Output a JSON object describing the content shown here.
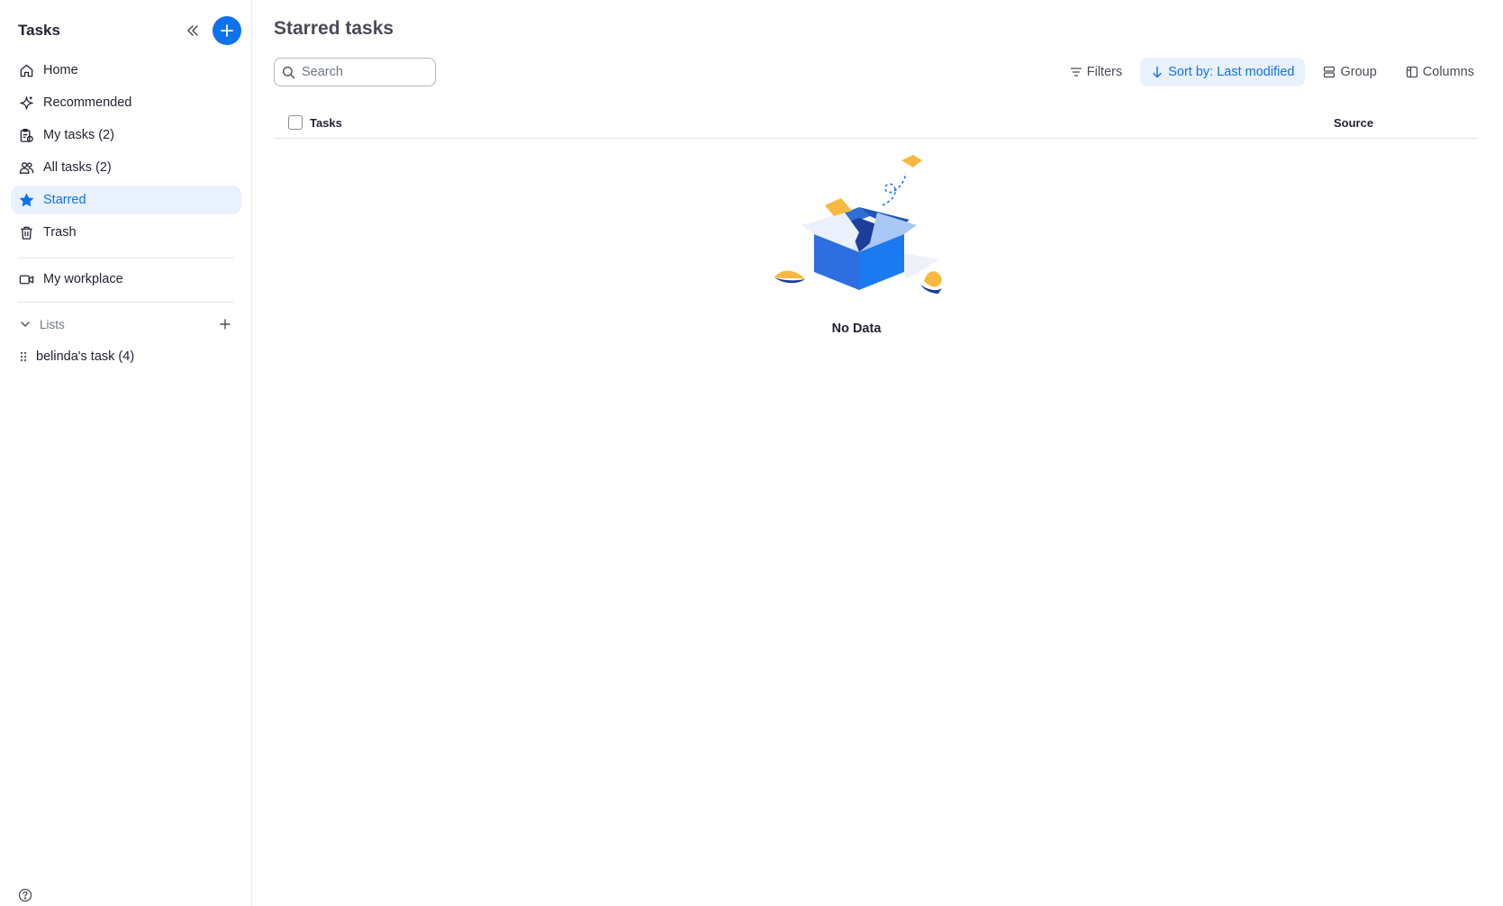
{
  "sidebar": {
    "title": "Tasks",
    "nav": [
      {
        "label": "Home",
        "icon": "home-icon"
      },
      {
        "label": "Recommended",
        "icon": "sparkle-icon"
      },
      {
        "label": "My tasks (2)",
        "icon": "my-tasks-icon"
      },
      {
        "label": "All tasks (2)",
        "icon": "people-icon"
      },
      {
        "label": "Starred",
        "icon": "star-icon",
        "active": true
      },
      {
        "label": "Trash",
        "icon": "trash-icon"
      }
    ],
    "workplace": {
      "label": "My workplace",
      "icon": "video-icon"
    },
    "lists": {
      "label": "Lists",
      "items": [
        {
          "label": "belinda's task (4)"
        }
      ]
    }
  },
  "main": {
    "title": "Starred tasks",
    "search": {
      "placeholder": "Search"
    },
    "toolbar": {
      "filters": "Filters",
      "sort": "Sort by: Last modified",
      "group": "Group",
      "columns": "Columns"
    },
    "table": {
      "columns": [
        "Tasks",
        "Source"
      ]
    },
    "empty_text": "No Data"
  },
  "colors": {
    "accent": "#0e72ed",
    "active_bg": "#e9f1fd",
    "text": "#232333",
    "muted": "#6e7680"
  }
}
